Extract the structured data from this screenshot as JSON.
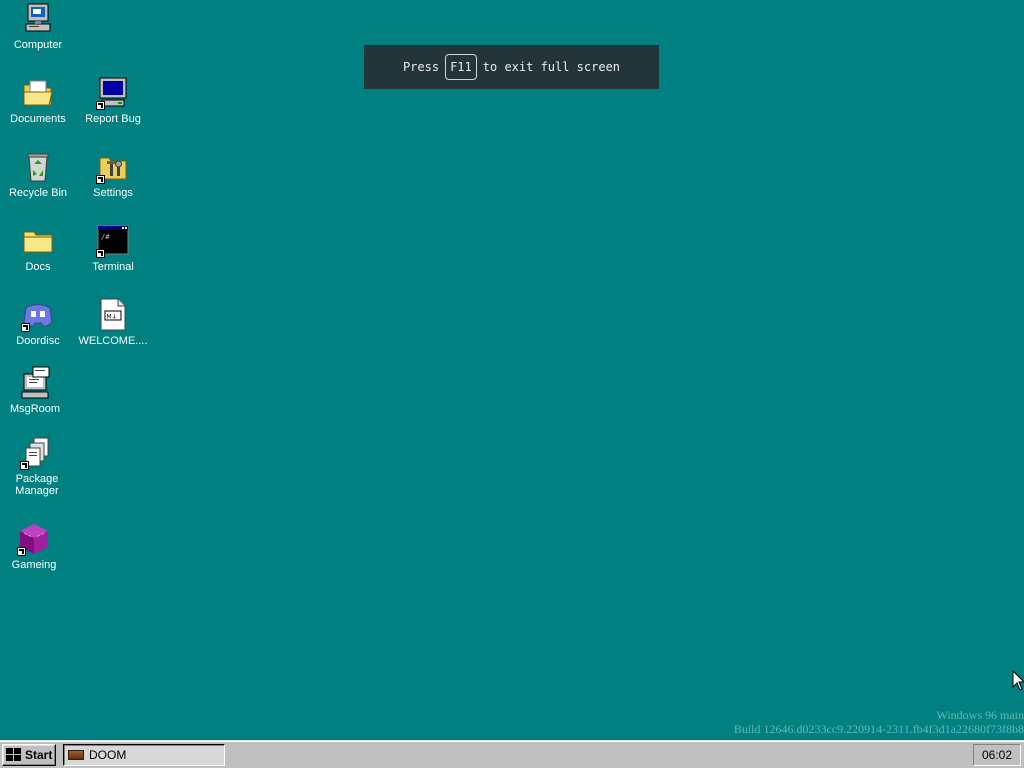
{
  "desktop": {
    "background_color": "#008080",
    "icons": [
      {
        "name": "computer",
        "label": "Computer",
        "icon": "computer-icon"
      },
      {
        "name": "documents",
        "label": "Documents",
        "icon": "folder-open-icon"
      },
      {
        "name": "report-bug",
        "label": "Report Bug",
        "icon": "monitor-icon"
      },
      {
        "name": "recycle-bin",
        "label": "Recycle Bin",
        "icon": "recycle-bin-icon"
      },
      {
        "name": "settings",
        "label": "Settings",
        "icon": "settings-folder-icon"
      },
      {
        "name": "docs",
        "label": "Docs",
        "icon": "folder-icon"
      },
      {
        "name": "terminal",
        "label": "Terminal",
        "icon": "terminal-icon"
      },
      {
        "name": "doordisc",
        "label": "Doordisc",
        "icon": "discord-icon"
      },
      {
        "name": "welcome",
        "label": "WELCOME....",
        "icon": "markdown-file-icon"
      },
      {
        "name": "msgroom",
        "label": "MsgRoom",
        "icon": "chat-computer-icon"
      },
      {
        "name": "package-manager",
        "label": "Package Manager",
        "icon": "package-icon"
      },
      {
        "name": "gameing",
        "label": "Gameing",
        "icon": "cube-icon"
      }
    ]
  },
  "fullscreen_notice": {
    "prefix": "Press",
    "key": "F11",
    "suffix": "to exit full screen"
  },
  "watermark": {
    "line1": "Windows 96 main",
    "line2": "Build 12646.d0233cc9.220914-2311.fb4f3d1a22680f73f8b8"
  },
  "taskbar": {
    "start_label": "Start",
    "tasks": [
      {
        "label": "DOOM",
        "icon": "doom-icon"
      }
    ],
    "clock": "06:02"
  }
}
